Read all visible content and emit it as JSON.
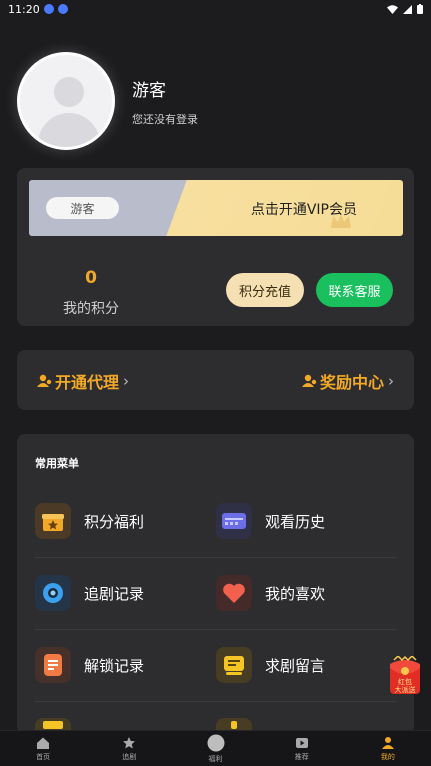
{
  "status": {
    "time": "11:20"
  },
  "profile": {
    "name": "游客",
    "hint": "您还没有登录"
  },
  "vip": {
    "badge": "游客",
    "cta": "点击开通VIP会员",
    "points_value": "0",
    "points_label": "我的积分",
    "recharge_label": "积分充值",
    "service_label": "联系客服"
  },
  "links": {
    "agent": "开通代理",
    "reward": "奖励中心"
  },
  "menu": {
    "title": "常用菜单",
    "items": [
      {
        "label": "积分福利",
        "icon": "gift-icon"
      },
      {
        "label": "观看历史",
        "icon": "history-icon"
      },
      {
        "label": "追剧记录",
        "icon": "record-icon"
      },
      {
        "label": "我的喜欢",
        "icon": "heart-icon"
      },
      {
        "label": "解锁记录",
        "icon": "unlock-icon"
      },
      {
        "label": "求剧留言",
        "icon": "message-icon"
      }
    ]
  },
  "floating": {
    "envelope_line1": "红包",
    "envelope_line2": "大派送"
  },
  "nav": {
    "items": [
      {
        "label": "首页",
        "icon": "home-icon"
      },
      {
        "label": "追剧",
        "icon": "star-icon"
      },
      {
        "label": "福利",
        "icon": "welfare-icon"
      },
      {
        "label": "推荐",
        "icon": "play-icon"
      },
      {
        "label": "我的",
        "icon": "profile-icon"
      }
    ]
  },
  "colors": {
    "background": "#1c1c1f",
    "card": "#2d2d30",
    "accent": "#f3a928",
    "service_green": "#19c05d",
    "recharge_beige": "#f4e0b2"
  }
}
